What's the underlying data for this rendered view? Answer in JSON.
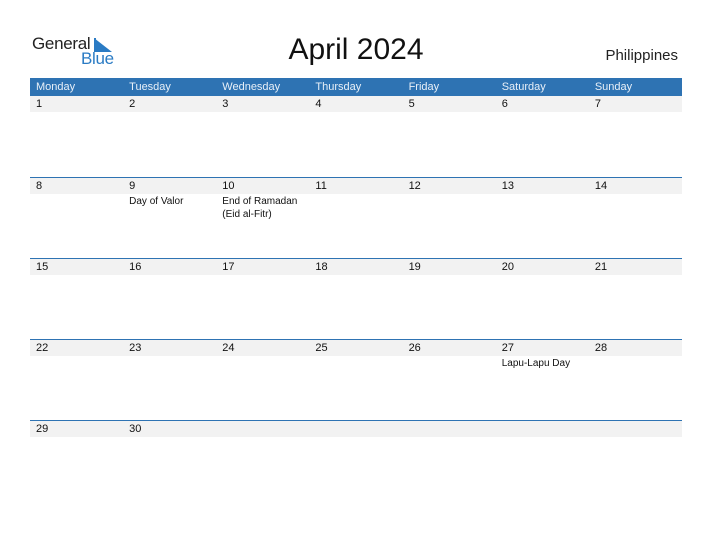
{
  "logo": {
    "general": "General",
    "blue": "Blue"
  },
  "title": "April 2024",
  "country": "Philippines",
  "weekdays": [
    "Monday",
    "Tuesday",
    "Wednesday",
    "Thursday",
    "Friday",
    "Saturday",
    "Sunday"
  ],
  "weeks": [
    {
      "days": [
        {
          "n": "1",
          "h": ""
        },
        {
          "n": "2",
          "h": ""
        },
        {
          "n": "3",
          "h": ""
        },
        {
          "n": "4",
          "h": ""
        },
        {
          "n": "5",
          "h": ""
        },
        {
          "n": "6",
          "h": ""
        },
        {
          "n": "7",
          "h": ""
        }
      ]
    },
    {
      "days": [
        {
          "n": "8",
          "h": ""
        },
        {
          "n": "9",
          "h": "Day of Valor"
        },
        {
          "n": "10",
          "h": "End of Ramadan (Eid al-Fitr)"
        },
        {
          "n": "11",
          "h": ""
        },
        {
          "n": "12",
          "h": ""
        },
        {
          "n": "13",
          "h": ""
        },
        {
          "n": "14",
          "h": ""
        }
      ]
    },
    {
      "days": [
        {
          "n": "15",
          "h": ""
        },
        {
          "n": "16",
          "h": ""
        },
        {
          "n": "17",
          "h": ""
        },
        {
          "n": "18",
          "h": ""
        },
        {
          "n": "19",
          "h": ""
        },
        {
          "n": "20",
          "h": ""
        },
        {
          "n": "21",
          "h": ""
        }
      ]
    },
    {
      "days": [
        {
          "n": "22",
          "h": ""
        },
        {
          "n": "23",
          "h": ""
        },
        {
          "n": "24",
          "h": ""
        },
        {
          "n": "25",
          "h": ""
        },
        {
          "n": "26",
          "h": ""
        },
        {
          "n": "27",
          "h": "Lapu-Lapu Day"
        },
        {
          "n": "28",
          "h": ""
        }
      ]
    },
    {
      "days": [
        {
          "n": "29",
          "h": ""
        },
        {
          "n": "30",
          "h": ""
        },
        {
          "n": "",
          "h": ""
        },
        {
          "n": "",
          "h": ""
        },
        {
          "n": "",
          "h": ""
        },
        {
          "n": "",
          "h": ""
        },
        {
          "n": "",
          "h": ""
        }
      ]
    }
  ],
  "colors": {
    "accent": "#2e73b3",
    "logo_blue": "#2a7bc4",
    "date_band": "#f2f2f2"
  }
}
